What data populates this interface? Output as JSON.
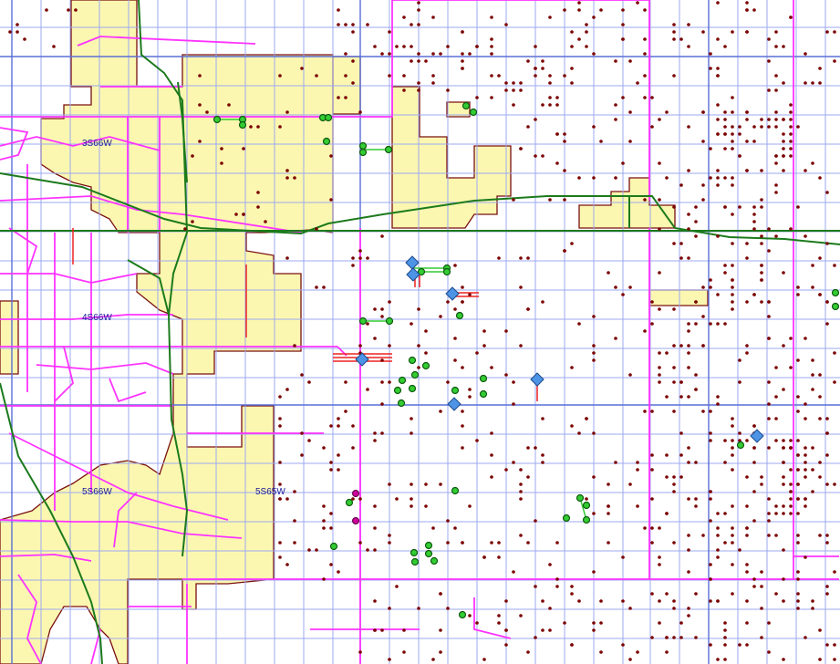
{
  "map": {
    "township_labels": [
      "3S66W",
      "4S66W",
      "5S66W",
      "5S65W"
    ],
    "colors": {
      "background": "#ffffff",
      "section_grid": "#9da8f0",
      "township_grid": "#5a6fd6",
      "municipal_fill": "#fbf7b0",
      "municipal_border": "#7a1010",
      "roads": "#ff33ff",
      "highways": "#1c7a1c",
      "well": "#7a0000",
      "green_well": "#33cc33",
      "green_well_stroke": "#0f5c0f",
      "blue_marker": "#4d94e6",
      "magenta_marker": "#cc0099",
      "red_segment": "#ee2222"
    },
    "icons": [
      "well-dot-icon",
      "green-well-icon",
      "blue-diamond-icon",
      "magenta-well-icon"
    ]
  }
}
